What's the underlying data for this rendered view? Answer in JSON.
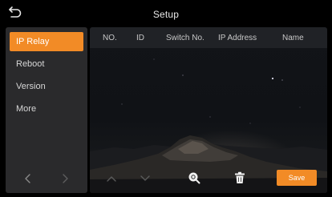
{
  "header": {
    "title": "Setup"
  },
  "sidebar": {
    "items": [
      {
        "label": "IP Relay",
        "active": true
      },
      {
        "label": "Reboot",
        "active": false
      },
      {
        "label": "Version",
        "active": false
      },
      {
        "label": "More",
        "active": false
      }
    ],
    "prev_icon": "chevron-left-icon",
    "next_icon": "chevron-right-icon"
  },
  "table": {
    "columns": [
      "NO.",
      "ID",
      "Switch No.",
      "IP Address",
      "Name"
    ],
    "rows": []
  },
  "toolbar": {
    "up_icon": "chevron-up-icon",
    "down_icon": "chevron-down-icon",
    "search_icon": "search-icon",
    "delete_icon": "trash-icon",
    "save_label": "Save"
  },
  "colors": {
    "accent": "#f28b26",
    "sidebar_bg": "#2a2a2c",
    "background": "#000000"
  }
}
